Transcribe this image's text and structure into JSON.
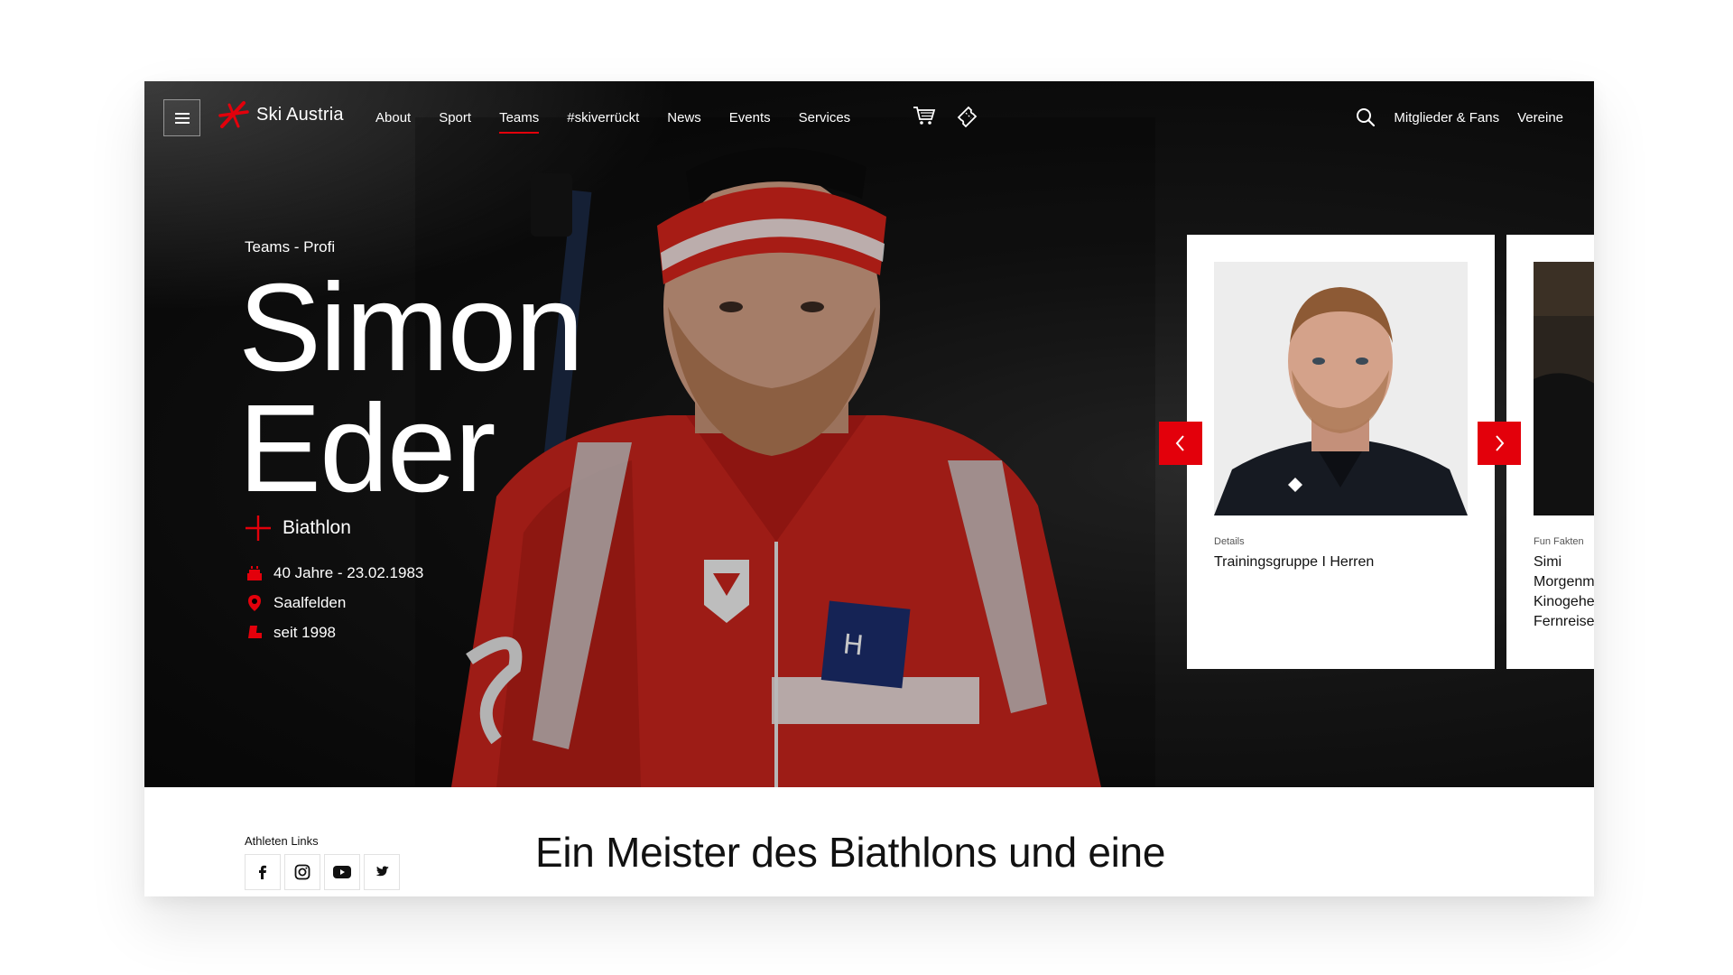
{
  "nav": {
    "brand": "Ski Austria",
    "links": [
      {
        "label": "About",
        "active": false
      },
      {
        "label": "Sport",
        "active": false
      },
      {
        "label": "Teams",
        "active": true
      },
      {
        "label": "#skiverrückt",
        "active": false
      },
      {
        "label": "News",
        "active": false
      },
      {
        "label": "Events",
        "active": false
      },
      {
        "label": "Services",
        "active": false
      }
    ],
    "icons": [
      "shopping-cart-icon",
      "ticket-icon",
      "search-icon",
      "menu-icon"
    ],
    "right": {
      "members": "Mitglieder & Fans",
      "clubs": "Vereine"
    }
  },
  "hero": {
    "breadcrumb": "Teams - Profi",
    "first_name": "Simon",
    "last_name": "Eder",
    "discipline": "Biathlon",
    "facts": [
      {
        "icon": "birthday-cake-icon",
        "text": "40 Jahre - 23.02.1983"
      },
      {
        "icon": "location-pin-icon",
        "text": "Saalfelden"
      },
      {
        "icon": "ski-boot-icon",
        "text": "seit 1998"
      }
    ]
  },
  "cards": [
    {
      "label": "Details",
      "title": "Trainingsgruppe I Herren"
    },
    {
      "label": "Fun Fakten",
      "title": "Simi Morgenm Kinogehe Fernreise"
    }
  ],
  "lower": {
    "links_label": "Athleten Links",
    "social": [
      "facebook-icon",
      "instagram-icon",
      "youtube-icon",
      "twitter-icon"
    ],
    "headline": "Ein Meister des Biathlons und eine"
  },
  "colors": {
    "accent": "#e3000b",
    "hero_bg": "#0a0a0a",
    "text_light": "#ffffff",
    "text_dark": "#111111"
  }
}
